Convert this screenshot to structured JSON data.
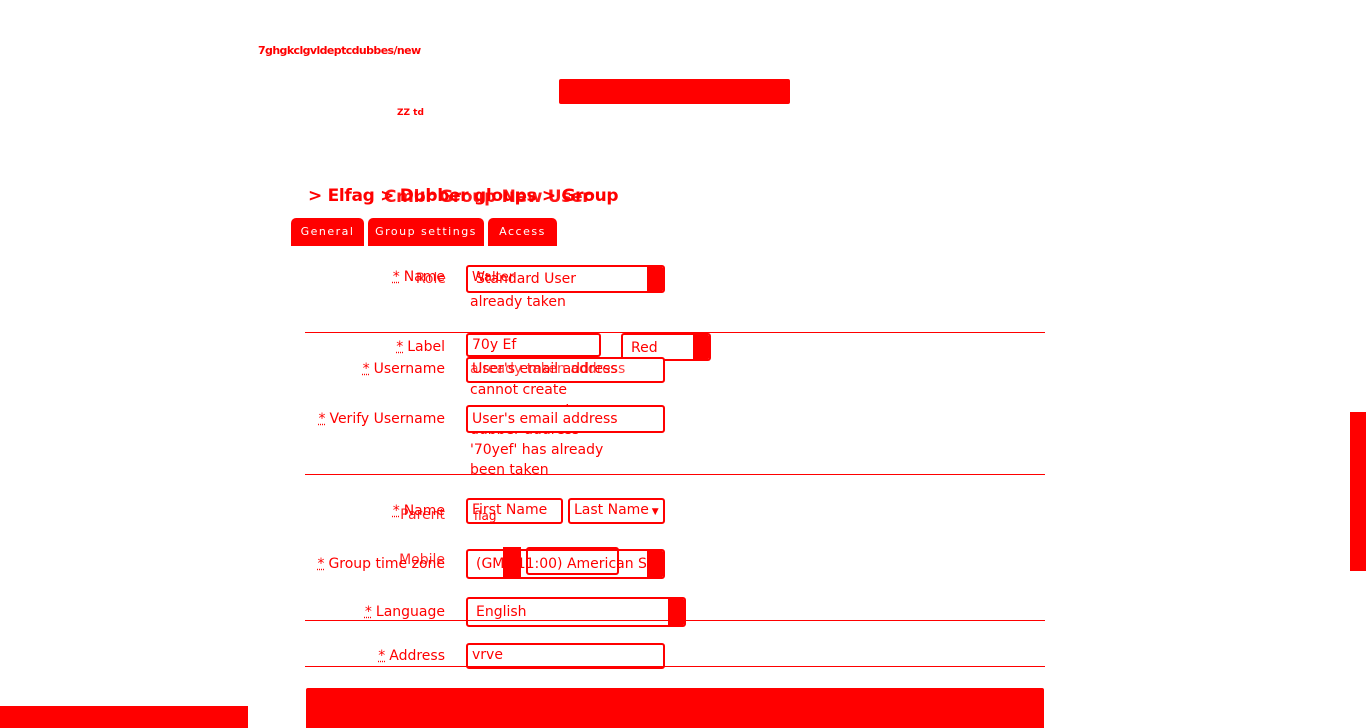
{
  "page": {
    "url": "7ghgkclgvldeptcdubbes/new",
    "tiny_text": "ZZ td",
    "breadcrumb": "> Elfag > Dubber gloups > Group",
    "breadcrumb_overlay": "Cmbr Group New User"
  },
  "tabs": [
    "General",
    "Group settings",
    "Access"
  ],
  "form": {
    "name_label": "Name",
    "role_label": "Role",
    "name_value": "Walter",
    "role_value": "Standard User",
    "name_error": "already taken",
    "label_label": "Label",
    "label_value": "70y Ef",
    "color_value": "Red",
    "username_label": "Username",
    "username_value": "User's email address",
    "username_overlay": "already taken address",
    "username_errors": [
      "cannot create",
      "group account",
      "dubber address"
    ],
    "verify_label": "Verify Username",
    "verify_value": "User's email address",
    "verify_errors": [
      "'70yef' has already",
      "been taken"
    ],
    "person_name_label": "Name",
    "parent_label": "Parent",
    "first_name": "First Name",
    "last_name": "Last Name",
    "parent_value": "flag",
    "mobile_label": "Mobile",
    "timezone_label": "Group time zone",
    "timezone_value": "(GMT-11:00) American Sa",
    "language_label": "Language",
    "language_value": "English",
    "address_label": "Address",
    "address_value": "vrve",
    "required_mark": "*"
  },
  "colors": {
    "accent": "#ff0000",
    "background": "#ffffff"
  }
}
